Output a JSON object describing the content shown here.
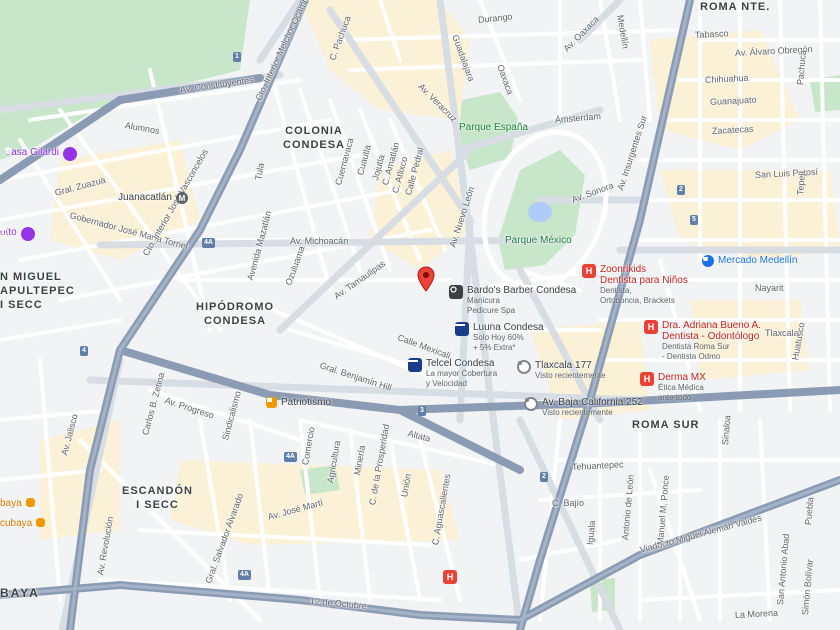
{
  "colors": {
    "background": "#f1f3f4",
    "street": "#ffffff",
    "avenue": "#d7dde3",
    "highway": "#8a9bb3",
    "park": "#c8e6c9",
    "commercial": "#fbf1d7",
    "hospital": "#ea4335",
    "pin": "#ea4335"
  },
  "neighborhoods": {
    "colonia_condesa": "COLONIA\nCONDESA",
    "hipodromo_condesa": "HIPÓDROMO\nCONDESA",
    "roma_sur": "ROMA SUR",
    "escandon": "ESCANDÓN\nI SECC",
    "san_miguel": "N MIGUEL\nAPULTEPEC\nI SECC",
    "roma_nte": "ROMA NTE."
  },
  "parks": {
    "parque_espana": "Parque España",
    "parque_mexico": "Parque México"
  },
  "pois": {
    "casa_gilardi": {
      "name": "Casa Gilardi",
      "icon": "museum-icon"
    },
    "utto": {
      "name": "utto",
      "icon": "museum-icon"
    },
    "juanacatlan": {
      "name": "Juanacatlán",
      "icon": "metro-icon"
    },
    "patriotismo": {
      "name": "Patriotismo",
      "icon": "metrobus-icon"
    },
    "bardos": {
      "name": "Bardo's Barber Condesa",
      "sub1": "Manicura",
      "sub2": "Pedicure Spa",
      "icon": "camera-icon"
    },
    "luuna": {
      "name": "Luuna Condesa",
      "sub1": "Solo Hoy 60%",
      "sub2": "+ 5% Extra*",
      "icon": "store-icon"
    },
    "telcel": {
      "name": "Telcel Condesa",
      "sub1": "La mayor Cobertura",
      "sub2": "y Velocidad",
      "icon": "store-icon"
    },
    "tlaxcala": {
      "name": "Tlaxcala 177",
      "sub1": "Visto recientemente",
      "icon": "history-icon"
    },
    "baja_california": {
      "name": "Av. Baja California 252",
      "sub1": "Visto recientemente",
      "icon": "history-icon"
    },
    "zoonrikids": {
      "name": "Zoonrikids",
      "sub1": "Dentista para Niños",
      "sub2": "Dentista,",
      "sub3": "Ortodoncia, Brackets",
      "icon": "hospital-icon"
    },
    "dra_adriana": {
      "name": "Dra. Adriana Bueno A.",
      "sub1": "Dentista - Odontólogo",
      "sub2": "Dentista Roma Sur",
      "sub3": "- Dentista Odmo",
      "icon": "hospital-icon"
    },
    "derma_mx": {
      "name": "Derma MX",
      "sub1": "Ética Médica",
      "sub2": "ante todo",
      "icon": "hospital-icon"
    },
    "mercado_medellin": {
      "name": "Mercado Medellín",
      "icon": "shop-icon"
    },
    "cubaya": {
      "name": "cubaya",
      "icon": "restaurant-icon"
    },
    "baya": {
      "name": "baya",
      "icon": "restaurant-icon"
    },
    "hospital_south": {
      "name": "",
      "icon": "hospital-icon"
    }
  },
  "streets": {
    "durango": "Durango",
    "oaxaca": "Av. Oaxaca",
    "medellin": "Medellín",
    "tabasco": "Tabasco",
    "alvaro_obregon": "Av. Álvaro Obregón",
    "chihuahua": "Chihuahua",
    "guanajuato": "Guanajuato",
    "zacatecas": "Zacatecas",
    "san_luis_potosi": "San Luis Potosí",
    "av_constituyentes": "Av. Constituyentes",
    "cto_interior_top": "Cto. Interior Melchor Ocampo",
    "c_pachuca": "C. Pachuca",
    "ave_veracruz": "Av. Veracruz",
    "guadalajara": "Guadalajara",
    "oaxaca2": "Oaxaca",
    "amsterdam": "Ámsterdam",
    "av_sonora": "Av. Sonora",
    "av_insurgentes": "Av. Insurgentes Sur",
    "alumnos": "Alumnos",
    "gral_zuazua": "Gral. Zuazua",
    "gobernador": "Gobernador José María Tornel",
    "cto_interior_west": "Cto. Interior José Vasconcelos",
    "tula": "Tula",
    "cuernavaca": "Cuernavaca",
    "cuautla": "Cuautla",
    "jojutla": "Jojutla",
    "c_amatlan": "C. Amatlán",
    "c_atlixco": "C. Atlixco",
    "calle_pedral": "Calle Pedral",
    "av_michoacan": "Av. Michoacán",
    "avenida_mazatlan": "Avenida Mazatlán",
    "ozuluama": "Ozuluama",
    "av_tamaulipas": "Av. Tamaulipas",
    "av_nuevo_leon": "Av. Nuevo León",
    "nayarit": "Nayarit",
    "tlaxcala": "Tlaxcala",
    "huatusco": "Huatusco",
    "calle_mexicali": "Calle Mexicali",
    "gral_benjamin_hill": "Gral. Benjamín Hill",
    "altata": "Altata",
    "av_jalisco": "Av. Jalisco",
    "carlos_b_zetina": "Carlos B. Zetina",
    "av_progreso": "Av. Progreso",
    "sindicalismo": "Sindicalismo",
    "comercio": "Comercio",
    "agricultura": "Agricultura",
    "mineria": "Minería",
    "c_prosperidad": "C. de la Prosperidad",
    "union": "Unión",
    "c_baja": "C. Bajío",
    "tehuantepec": "Tehuantepec",
    "av_jose_marti": "Av. José Martí",
    "gral_salvador_alvarado": "Gral. Salvador Alvarado",
    "av_revolucion": "Av. Revolución",
    "doce_octubre": "12 de Octubre",
    "c_aguascalientes": "C. Aguascalientes",
    "viaducto": "Viaducto Miguel Alemán Valdés",
    "la_morena": "La Morena",
    "iguala": "Iguala",
    "antonio_de_leon": "Antonio de León",
    "manuel_m_ponce": "Manuel M. Ponce",
    "san_antonio": "San Antonio Abad",
    "simon_bolivar": "Simón Bolívar",
    "tepeji": "Tepeji",
    "puebla": "Puebla",
    "sinaloa": "Sinaloa",
    "pachuca_n": "Pachuca"
  },
  "route_badges": [
    "1",
    "2",
    "3",
    "4",
    "4A",
    "5"
  ]
}
